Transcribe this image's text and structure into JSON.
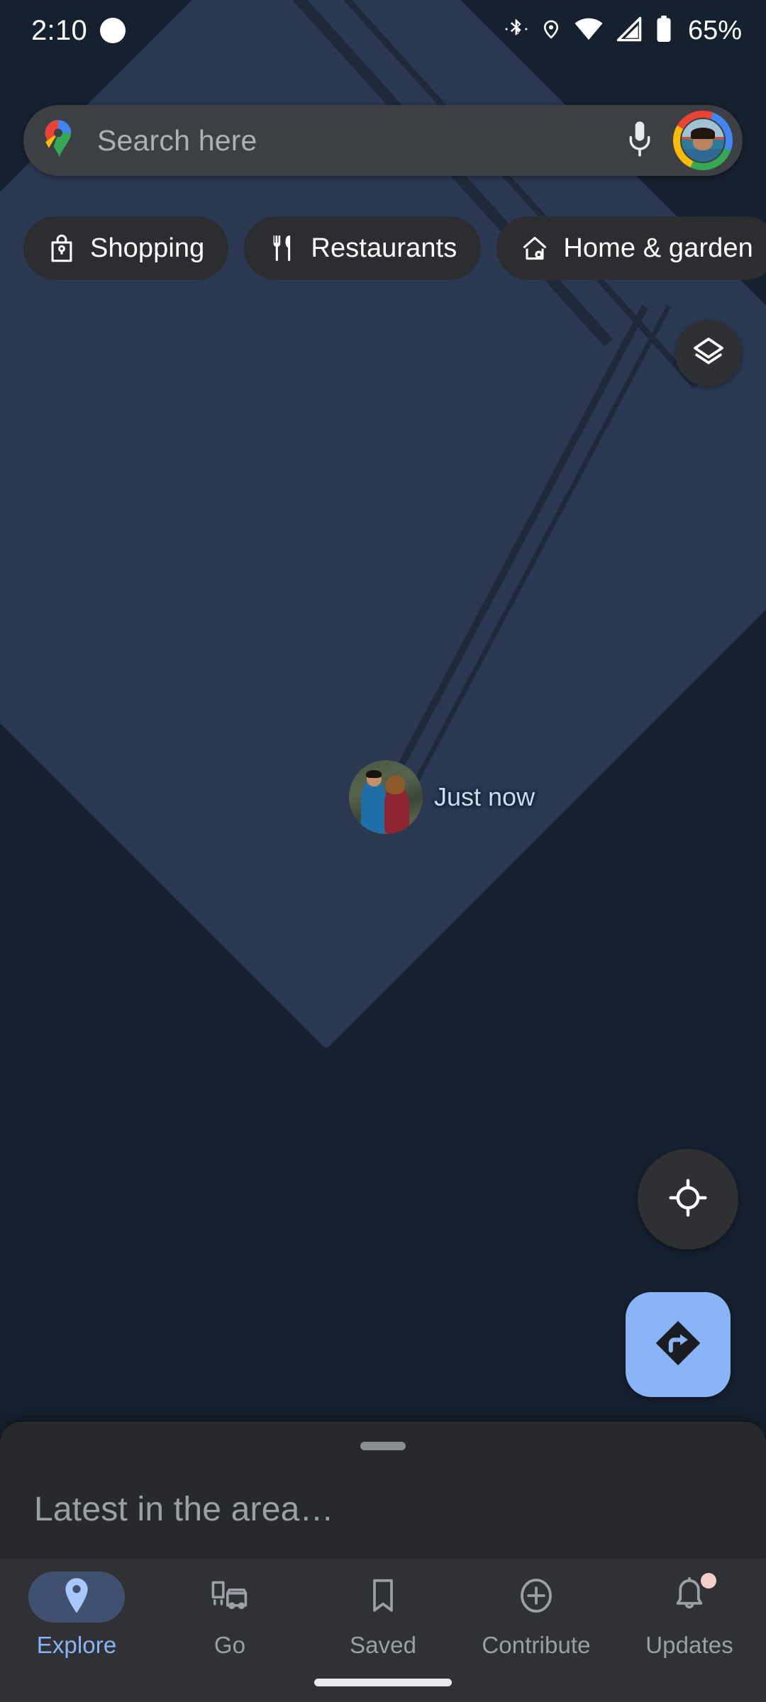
{
  "status_bar": {
    "time": "2:10",
    "battery_percent": "65%",
    "icons": [
      "notification-bubble-icon",
      "bluetooth-icon",
      "location-icon",
      "wifi-icon",
      "cellular-signal-icon",
      "battery-icon"
    ]
  },
  "search": {
    "placeholder": "Search here",
    "logo": "google-maps-pin-logo",
    "mic_icon": "microphone-icon",
    "avatar": "profile-avatar"
  },
  "chips": [
    {
      "label": "Shopping",
      "icon": "shopping-bag-icon"
    },
    {
      "label": "Restaurants",
      "icon": "fork-knife-icon"
    },
    {
      "label": "Home & garden",
      "icon": "house-icon"
    }
  ],
  "map_controls": {
    "layers_icon": "layers-icon",
    "mylocation_icon": "crosshair-icon",
    "directions_icon": "directions-arrow-icon"
  },
  "map_marker": {
    "label": "Just now",
    "photo": "friend-photo-avatar"
  },
  "bottom_sheet": {
    "title": "Latest in the area…",
    "handle": "drag-handle"
  },
  "bottom_nav": [
    {
      "label": "Explore",
      "icon": "location-pin-icon",
      "active": true,
      "badge": false
    },
    {
      "label": "Go",
      "icon": "commute-car-icon",
      "active": false,
      "badge": false
    },
    {
      "label": "Saved",
      "icon": "bookmark-icon",
      "active": false,
      "badge": false
    },
    {
      "label": "Contribute",
      "icon": "plus-circle-icon",
      "active": false,
      "badge": false
    },
    {
      "label": "Updates",
      "icon": "bell-icon",
      "active": false,
      "badge": true
    }
  ],
  "colors": {
    "map_base": "#16202E",
    "map_land": "#2A3852",
    "search_bg": "#3C3F43",
    "chip_bg": "#2B2D30",
    "sheet_bg": "#28292C",
    "nav_bg": "#303134",
    "accent_blue": "#8AB4F8",
    "muted_text": "#9AA0A6",
    "badge_pink": "#F6CFCB"
  }
}
